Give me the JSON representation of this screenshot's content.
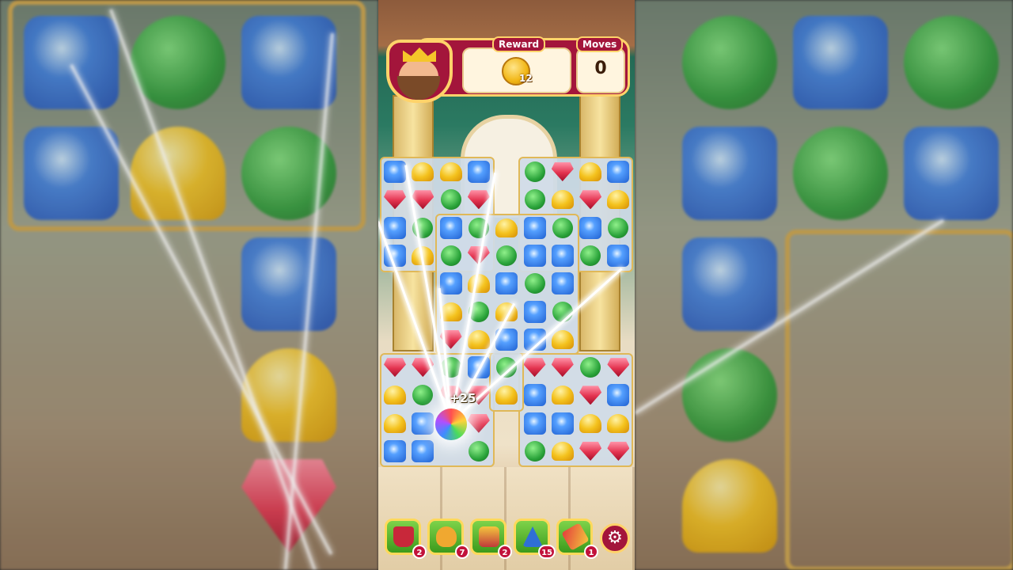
{
  "header": {
    "reward_label": "Reward",
    "reward_coins": "12",
    "moves_label": "Moves",
    "moves_value": "0"
  },
  "board": {
    "score_popup": "+25",
    "special_piece": "rainbow-ball",
    "piece_types": [
      "blue-tower",
      "green-clover",
      "gold-helmet",
      "red-gem"
    ]
  },
  "boosters": [
    {
      "name": "mailbox-booster",
      "icon": "mailbox-icon",
      "count": "2"
    },
    {
      "name": "royal-hand-booster",
      "icon": "hand-icon",
      "count": "7"
    },
    {
      "name": "cannon-booster",
      "icon": "cannon-icon",
      "count": "2"
    },
    {
      "name": "wizard-hat-booster",
      "icon": "wizard-hat-icon",
      "count": "15"
    },
    {
      "name": "firework-booster",
      "icon": "firework-icon",
      "count": "1"
    }
  ],
  "settings": {
    "icon": "gear-icon",
    "glyph": "⚙"
  },
  "colors": {
    "header_red": "#a3153b",
    "gold_border": "#ffd36a",
    "booster_green": "#5cb52e"
  }
}
